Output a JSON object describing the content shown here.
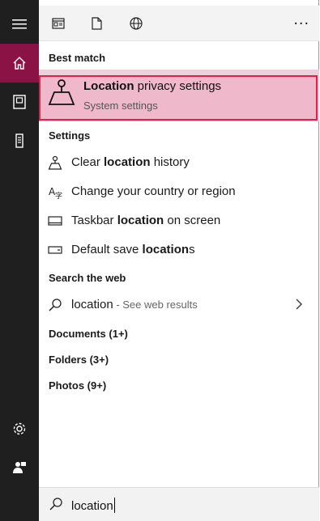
{
  "rail": {
    "items": [
      {
        "icon": "hamburger-menu-icon"
      },
      {
        "icon": "home-icon",
        "active": true
      },
      {
        "icon": "documents-icon"
      },
      {
        "icon": "device-icon"
      },
      {
        "icon": "settings-gear-icon"
      },
      {
        "icon": "feedback-person-icon"
      }
    ]
  },
  "toolbar": {
    "filters": [
      "apps-filter-icon",
      "documents-filter-icon",
      "web-filter-icon"
    ],
    "more_label": "..."
  },
  "best_match": {
    "header": "Best match",
    "title_bold": "Location",
    "title_rest": " privacy settings",
    "subtitle": "System settings"
  },
  "settings": {
    "header": "Settings",
    "items": [
      {
        "pre": "Clear ",
        "bold": "location",
        "post": " history",
        "icon": "location-pin-icon"
      },
      {
        "pre": "Change your country or region",
        "bold": "",
        "post": "",
        "icon": "language-icon"
      },
      {
        "pre": "Taskbar ",
        "bold": "location",
        "post": " on screen",
        "icon": "taskbar-icon"
      },
      {
        "pre": "Default save ",
        "bold": "location",
        "post": "s",
        "icon": "storage-icon"
      }
    ]
  },
  "web": {
    "header": "Search the web",
    "query": "location",
    "hint": " - See web results"
  },
  "groups": [
    "Documents (1+)",
    "Folders (3+)",
    "Photos (9+)"
  ],
  "search": {
    "value": "location"
  },
  "colors": {
    "rail_bg": "#1f1f1f",
    "rail_active": "#8a1244",
    "best_bg": "#f0b8cb",
    "best_border": "#e0224a"
  }
}
